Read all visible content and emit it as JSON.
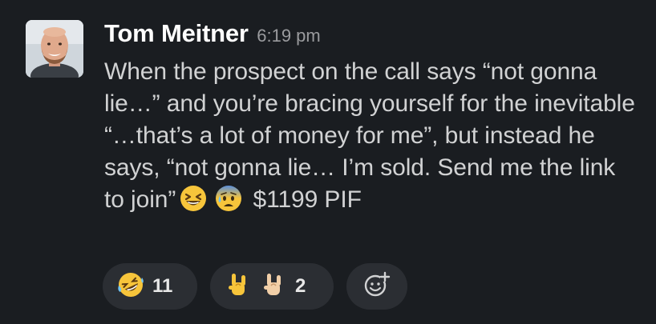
{
  "message": {
    "author": "Tom Meitner",
    "timestamp": "6:19 pm",
    "text_main": "When the prospect on the call says “not gonna lie…” and you’re bracing yourself for the inevitable “…that’s a lot of money for me”, but instead he says, “not gonna lie… I’m sold. Send me the link to join”",
    "text_tail": "$1199 PIF",
    "inline_emojis": [
      "grinning-squinting-face",
      "anxious-face-with-sweat"
    ]
  },
  "reactions": [
    {
      "emojis": [
        "rolling-on-the-floor-laughing"
      ],
      "count": "11"
    },
    {
      "emojis": [
        "sign-of-the-horns",
        "sign-of-the-horns-light-skin"
      ],
      "count": "2"
    }
  ],
  "add_reaction_icon": "add-reaction-icon",
  "colors": {
    "background": "#1a1d21",
    "pill": "#2b2e33",
    "text": "#d1d2d3",
    "author": "#ffffff",
    "timestamp": "#9a9b9e"
  }
}
